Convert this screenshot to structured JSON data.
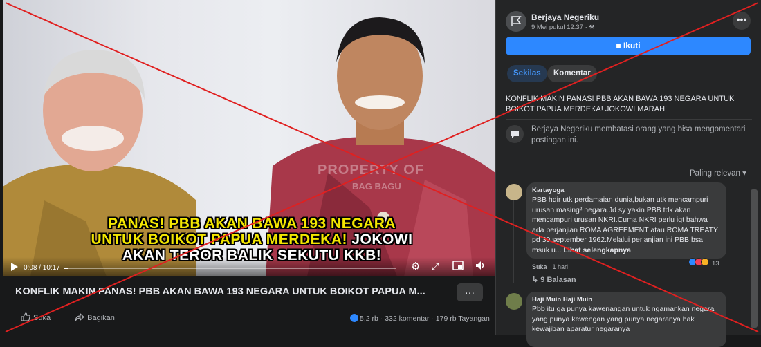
{
  "video": {
    "watermark": "PROPERTY OF",
    "watermark2": "BAG BAGU",
    "caption_yellow_1": "PANAS! PBB AKAN BAWA 193 NEGARA",
    "caption_yellow_2": "UNTUK BOIKOT PAPUA MERDEKA!",
    "caption_white_2": "JOKOWI",
    "caption_white_3": "AKAN TEROR BALIK SEKUTU KKB!",
    "time": "0:08 / 10:17",
    "progress": 0.013,
    "title": "KONFLIK MAKIN PANAS! PBB AKAN BAWA 193 NEGARA UNTUK BOIKOT PAPUA M...",
    "more": "…"
  },
  "actions": {
    "like": "Suka",
    "share": "Bagikan"
  },
  "stats": {
    "reactions": "5,2 rb",
    "comments": "332 komentar",
    "views": "179 rb Tayangan",
    "separator": "·"
  },
  "post": {
    "page_name": "Berjaya Negeriku",
    "date": "9 Mei pukul 12.37 ·",
    "follow_label": "Ikuti",
    "tab_overview": "Sekilas",
    "tab_comments": "Komentar",
    "text": "KONFLIK MAKIN PANAS! PBB AKAN BAWA 193 NEGARA UNTUK BOIKOT PAPUA MERDEKA! JOKOWI MARAH!",
    "notice": "Berjaya Negeriku membatasi orang yang bisa mengomentari postingan ini.",
    "sort": "Paling relevan"
  },
  "comments": [
    {
      "name": "Kartayoga",
      "text": "PBB hdir utk perdamaian dunia,bukan utk mencampuri urusan masing² negara.Jd sy yakin PBB tdk akan mencampuri urusan NKRI.Cuma NKRI perlu igt bahwa ada perjanjian ROMA AGREEMENT atau ROMA TREATY pd 30 september 1962.Melalui perjanjian ini PBB bsa msuk u...",
      "see_more": "Lihat selengkapnya",
      "reaction_count": "13",
      "like": "Suka",
      "age": "1 hari",
      "replies": "9 Balasan"
    },
    {
      "name": "Haji Muin Haji Muin",
      "text": "Pbb itu ga punya kawenangan untuk ngamankan negara yang punya kewengan yang punya negaranya hak kewajiban aparatur negaranya"
    }
  ],
  "colors": {
    "accent": "#2d88ff",
    "caption_yellow": "#f3e600",
    "cross": "#e02020"
  }
}
